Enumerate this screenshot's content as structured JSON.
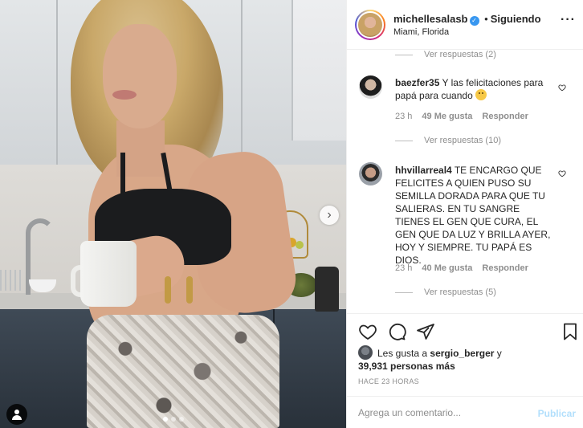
{
  "post": {
    "username": "michellesalasb",
    "follow_separator": "•",
    "follow_label": "Siguiendo",
    "location": "Miami, Florida",
    "more_label": "···"
  },
  "photo": {
    "next_glyph": "›",
    "slide_count": 3,
    "active_slide": 0
  },
  "comments": [
    {
      "type": "view_replies",
      "label": "Ver respuestas (2)"
    },
    {
      "type": "comment",
      "user": "baezfer35",
      "text": "Y las felicitaciones para papá para cuando",
      "emoji": "worried-face",
      "time": "23 h",
      "likes": "49 Me gusta",
      "reply": "Responder"
    },
    {
      "type": "view_replies",
      "label": "Ver respuestas (10)"
    },
    {
      "type": "comment",
      "user": "hhvillarreal4",
      "text": "TE ENCARGO QUE FELICITES A QUIEN PUSO SU SEMILLA DORADA PARA QUE TU SALIERAS. EN TU SANGRE TIENES EL GEN QUE CURA, EL GEN QUE DA LUZ Y BRILLA AYER, HOY Y SIEMPRE. TU PAPÁ ES DIOS.",
      "time": "23 h",
      "likes": "40 Me gusta",
      "reply": "Responder"
    },
    {
      "type": "view_replies",
      "label": "Ver respuestas (5)"
    }
  ],
  "likes": {
    "prefix": "Les gusta a",
    "user": "sergio_berger",
    "connector": "y",
    "count": "39,931 personas más"
  },
  "time_ago": "HACE 23 HORAS",
  "comment_box": {
    "placeholder": "Agrega un comentario...",
    "publish_label": "Publicar"
  },
  "icons": {
    "verified": "verified-badge-icon",
    "heart": "heart-icon",
    "comment": "comment-icon",
    "share": "paper-plane-icon",
    "save": "bookmark-icon",
    "tag": "user-tag-icon",
    "next": "chevron-right-icon"
  },
  "colors": {
    "verified_blue": "#3897f0",
    "muted_text": "#8e8e8e",
    "publish_disabled": "#b2dffc",
    "divider": "#efefef"
  }
}
